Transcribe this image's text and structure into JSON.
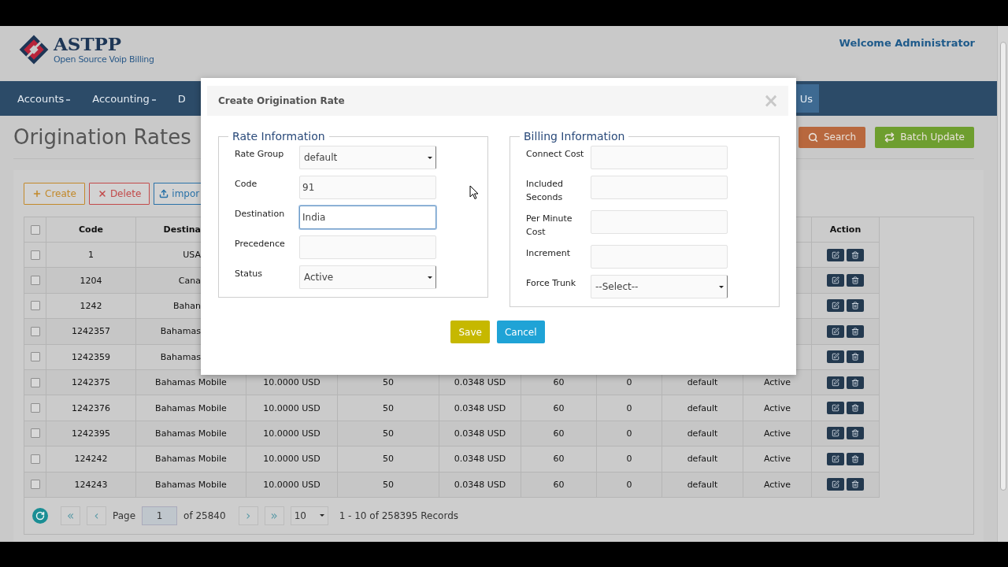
{
  "header": {
    "logo_name": "ASTPP",
    "tagline": "Open Source Voip Billing",
    "welcome": "Welcome Administrator"
  },
  "nav": [
    {
      "label": "Accounts",
      "dropdown": true,
      "selected": false
    },
    {
      "label": "Accounting",
      "dropdown": true,
      "selected": false
    },
    {
      "label": "D",
      "dropdown": false,
      "selected": false
    },
    {
      "label": "Us",
      "dropdown": false,
      "selected": true
    }
  ],
  "page_title": "Origination Rates",
  "actions": [
    {
      "label": "Search",
      "kind": "search"
    },
    {
      "label": "Batch Update",
      "kind": "batch"
    }
  ],
  "toolbar": [
    {
      "label": "Create",
      "kind": "create"
    },
    {
      "label": "Delete",
      "kind": "delete"
    },
    {
      "label": "impor",
      "kind": "import"
    }
  ],
  "table": {
    "header_checked": false,
    "columns": [
      "Code",
      "Destina",
      "Action"
    ],
    "rows": [
      {
        "checked": false,
        "cells": [
          "1",
          "USA"
        ]
      },
      {
        "checked": false,
        "cells": [
          "1204",
          "Cana"
        ]
      },
      {
        "checked": false,
        "cells": [
          "1242",
          "Bahan"
        ]
      },
      {
        "checked": false,
        "cells": [
          "1242357",
          "Bahamas"
        ]
      },
      {
        "checked": false,
        "cells": [
          "1242359",
          "Bahamas"
        ]
      },
      {
        "checked": false,
        "cells": [
          "1242375",
          "Bahamas Mobile",
          "10.0000 USD",
          "50",
          "0.0348 USD",
          "60",
          "0",
          "default",
          "Active"
        ]
      },
      {
        "checked": false,
        "cells": [
          "1242376",
          "Bahamas Mobile",
          "10.0000 USD",
          "50",
          "0.0348 USD",
          "60",
          "0",
          "default",
          "Active"
        ]
      },
      {
        "checked": false,
        "cells": [
          "1242395",
          "Bahamas Mobile",
          "10.0000 USD",
          "50",
          "0.0348 USD",
          "60",
          "0",
          "default",
          "Active"
        ]
      },
      {
        "checked": false,
        "cells": [
          "124242",
          "Bahamas Mobile",
          "10.0000 USD",
          "50",
          "0.0348 USD",
          "60",
          "0",
          "default",
          "Active"
        ]
      },
      {
        "checked": false,
        "cells": [
          "124243",
          "Bahamas Mobile",
          "10.0000 USD",
          "50",
          "0.0348 USD",
          "60",
          "0",
          "default",
          "Active"
        ]
      }
    ]
  },
  "pager": {
    "first": "«",
    "prev": "‹",
    "page_label": "Page",
    "page": "1",
    "of": "of 25840",
    "next": "›",
    "last": "»",
    "page_size": "10",
    "summary": "1 - 10 of 258395 Records"
  },
  "modal": {
    "title": "Create Origination Rate",
    "close": "×",
    "sections": [
      {
        "legend": "Rate Information",
        "fields": [
          {
            "label": "Rate Group",
            "kind": "select",
            "value": "default",
            "focused": false
          },
          {
            "label": "Code",
            "kind": "text",
            "value": "91",
            "focused": false
          },
          {
            "label": "Destination",
            "kind": "text",
            "value": "India",
            "focused": true
          },
          {
            "label": "Precedence",
            "kind": "text",
            "focused": false
          },
          {
            "label": "Status",
            "kind": "select",
            "value": "Active",
            "focused": false
          }
        ]
      },
      {
        "legend": "Billing Information",
        "fields": [
          {
            "label": "Connect Cost",
            "kind": "text",
            "focused": false
          },
          {
            "label": "Included Seconds",
            "kind": "text",
            "focused": false
          },
          {
            "label": "Per Minute Cost",
            "kind": "text",
            "focused": false
          },
          {
            "label": "Increment",
            "kind": "text",
            "focused": false
          },
          {
            "label": "Force Trunk",
            "kind": "select",
            "value": "--Select--",
            "focused": false
          }
        ]
      }
    ],
    "buttons": [
      {
        "label": "Save",
        "kind": "save"
      },
      {
        "label": "Cancel",
        "kind": "cancel"
      }
    ]
  }
}
